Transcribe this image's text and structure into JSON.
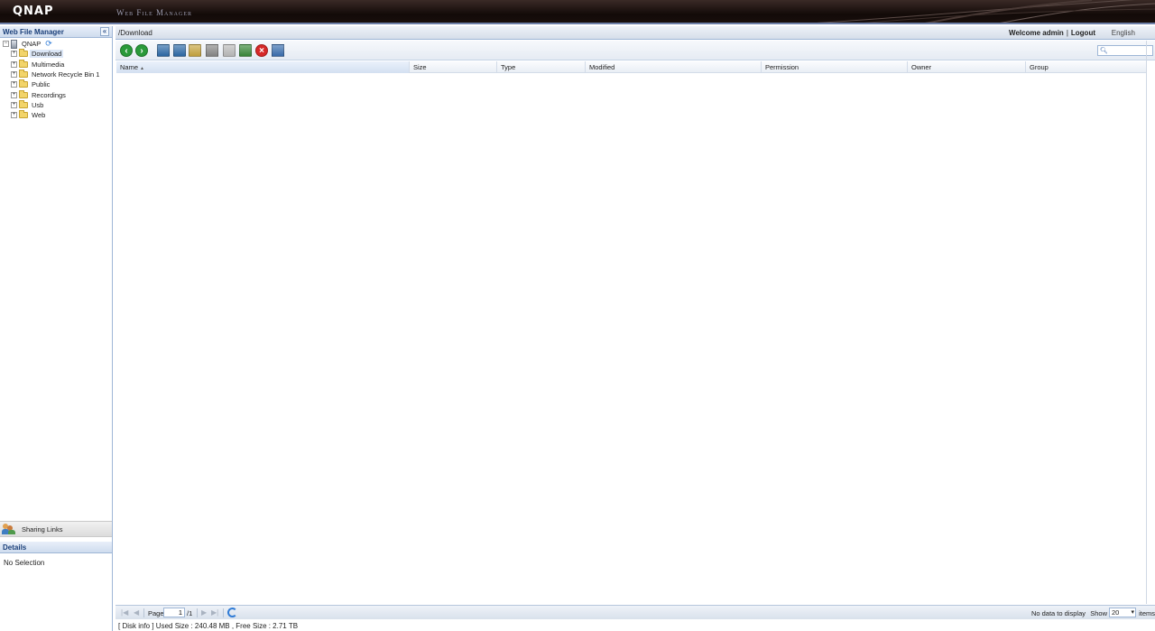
{
  "header": {
    "logo": "QNAP",
    "app_title": "Web File Manager"
  },
  "sidebar": {
    "title": "Web File Manager",
    "collapse_glyph": "«",
    "root": {
      "label": "QNAP",
      "icon": "nas-icon"
    },
    "folders": [
      {
        "label": "Download",
        "selected": true
      },
      {
        "label": "Multimedia",
        "selected": false
      },
      {
        "label": "Network Recycle Bin 1",
        "selected": false
      },
      {
        "label": "Public",
        "selected": false
      },
      {
        "label": "Recordings",
        "selected": false
      },
      {
        "label": "Usb",
        "selected": false
      },
      {
        "label": "Web",
        "selected": false
      }
    ],
    "sharing_links": "Sharing Links",
    "details_title": "Details",
    "details_text": "No Selection"
  },
  "main": {
    "path": "/Download",
    "welcome": "Welcome admin",
    "logout": "Logout",
    "language": "English",
    "search": {
      "placeholder": "",
      "value": ""
    },
    "toolbar": [
      {
        "name": "back-icon",
        "color": "#2a9a3a"
      },
      {
        "name": "forward-icon",
        "color": "#2a9a3a"
      },
      {
        "name": "upload-icon",
        "color": "#2d6aa8"
      },
      {
        "name": "download-icon",
        "color": "#2d6aa8"
      },
      {
        "name": "new-folder-icon",
        "color": "#c8a640"
      },
      {
        "name": "rename-icon",
        "color": "#888888"
      },
      {
        "name": "copy-icon",
        "color": "#bbbbbb"
      },
      {
        "name": "move-icon",
        "color": "#3a8a3a"
      },
      {
        "name": "delete-icon",
        "color": "#d62828"
      },
      {
        "name": "share-icon",
        "color": "#3a6fb0"
      }
    ],
    "columns": [
      "Name",
      "Size",
      "Type",
      "Modified",
      "Permission",
      "Owner",
      "Group"
    ],
    "sorted_column": "Name",
    "rows": []
  },
  "pager": {
    "page_label": "Page",
    "page_value": "1",
    "page_total": "/1",
    "no_data": "No data to display",
    "show_label": "Show",
    "show_value": "20",
    "items_label": "items"
  },
  "disk_info": "[ Disk info ] Used Size : 240.48 MB , Free Size : 2.71 TB"
}
